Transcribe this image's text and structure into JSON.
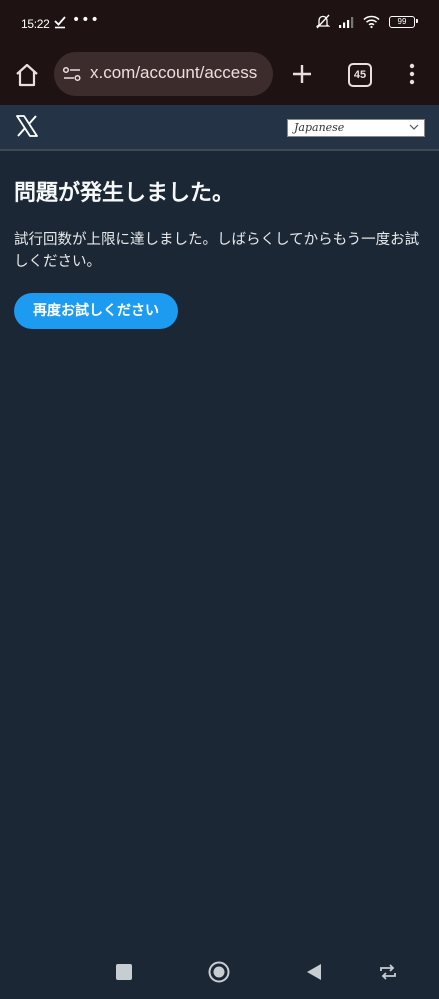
{
  "status_bar": {
    "time": "15:22",
    "battery": "99"
  },
  "browser": {
    "url": "x.com/account/access",
    "tab_count": "45"
  },
  "header": {
    "language": "Japanese"
  },
  "main": {
    "title": "問題が発生しました。",
    "message": "試行回数が上限に達しました。しばらくしてからもう一度お試しください。",
    "retry_label": "再度お試しください"
  },
  "colors": {
    "page_bg": "#1b2734",
    "header_bg": "#243346",
    "browser_bg": "#1f1213",
    "accent": "#1d9bf0"
  },
  "icons": {
    "status": [
      "check-icon",
      "more-dots-icon",
      "bell-off-icon",
      "signal-icon",
      "wifi-icon",
      "battery-icon"
    ],
    "browser": [
      "home-icon",
      "tune-icon",
      "plus-icon",
      "tabs-icon",
      "kebab-menu-icon"
    ],
    "header": [
      "x-logo-icon",
      "chevron-down-icon"
    ],
    "nav": [
      "recents-icon",
      "home-circle-icon",
      "back-icon",
      "rotate-icon"
    ]
  }
}
